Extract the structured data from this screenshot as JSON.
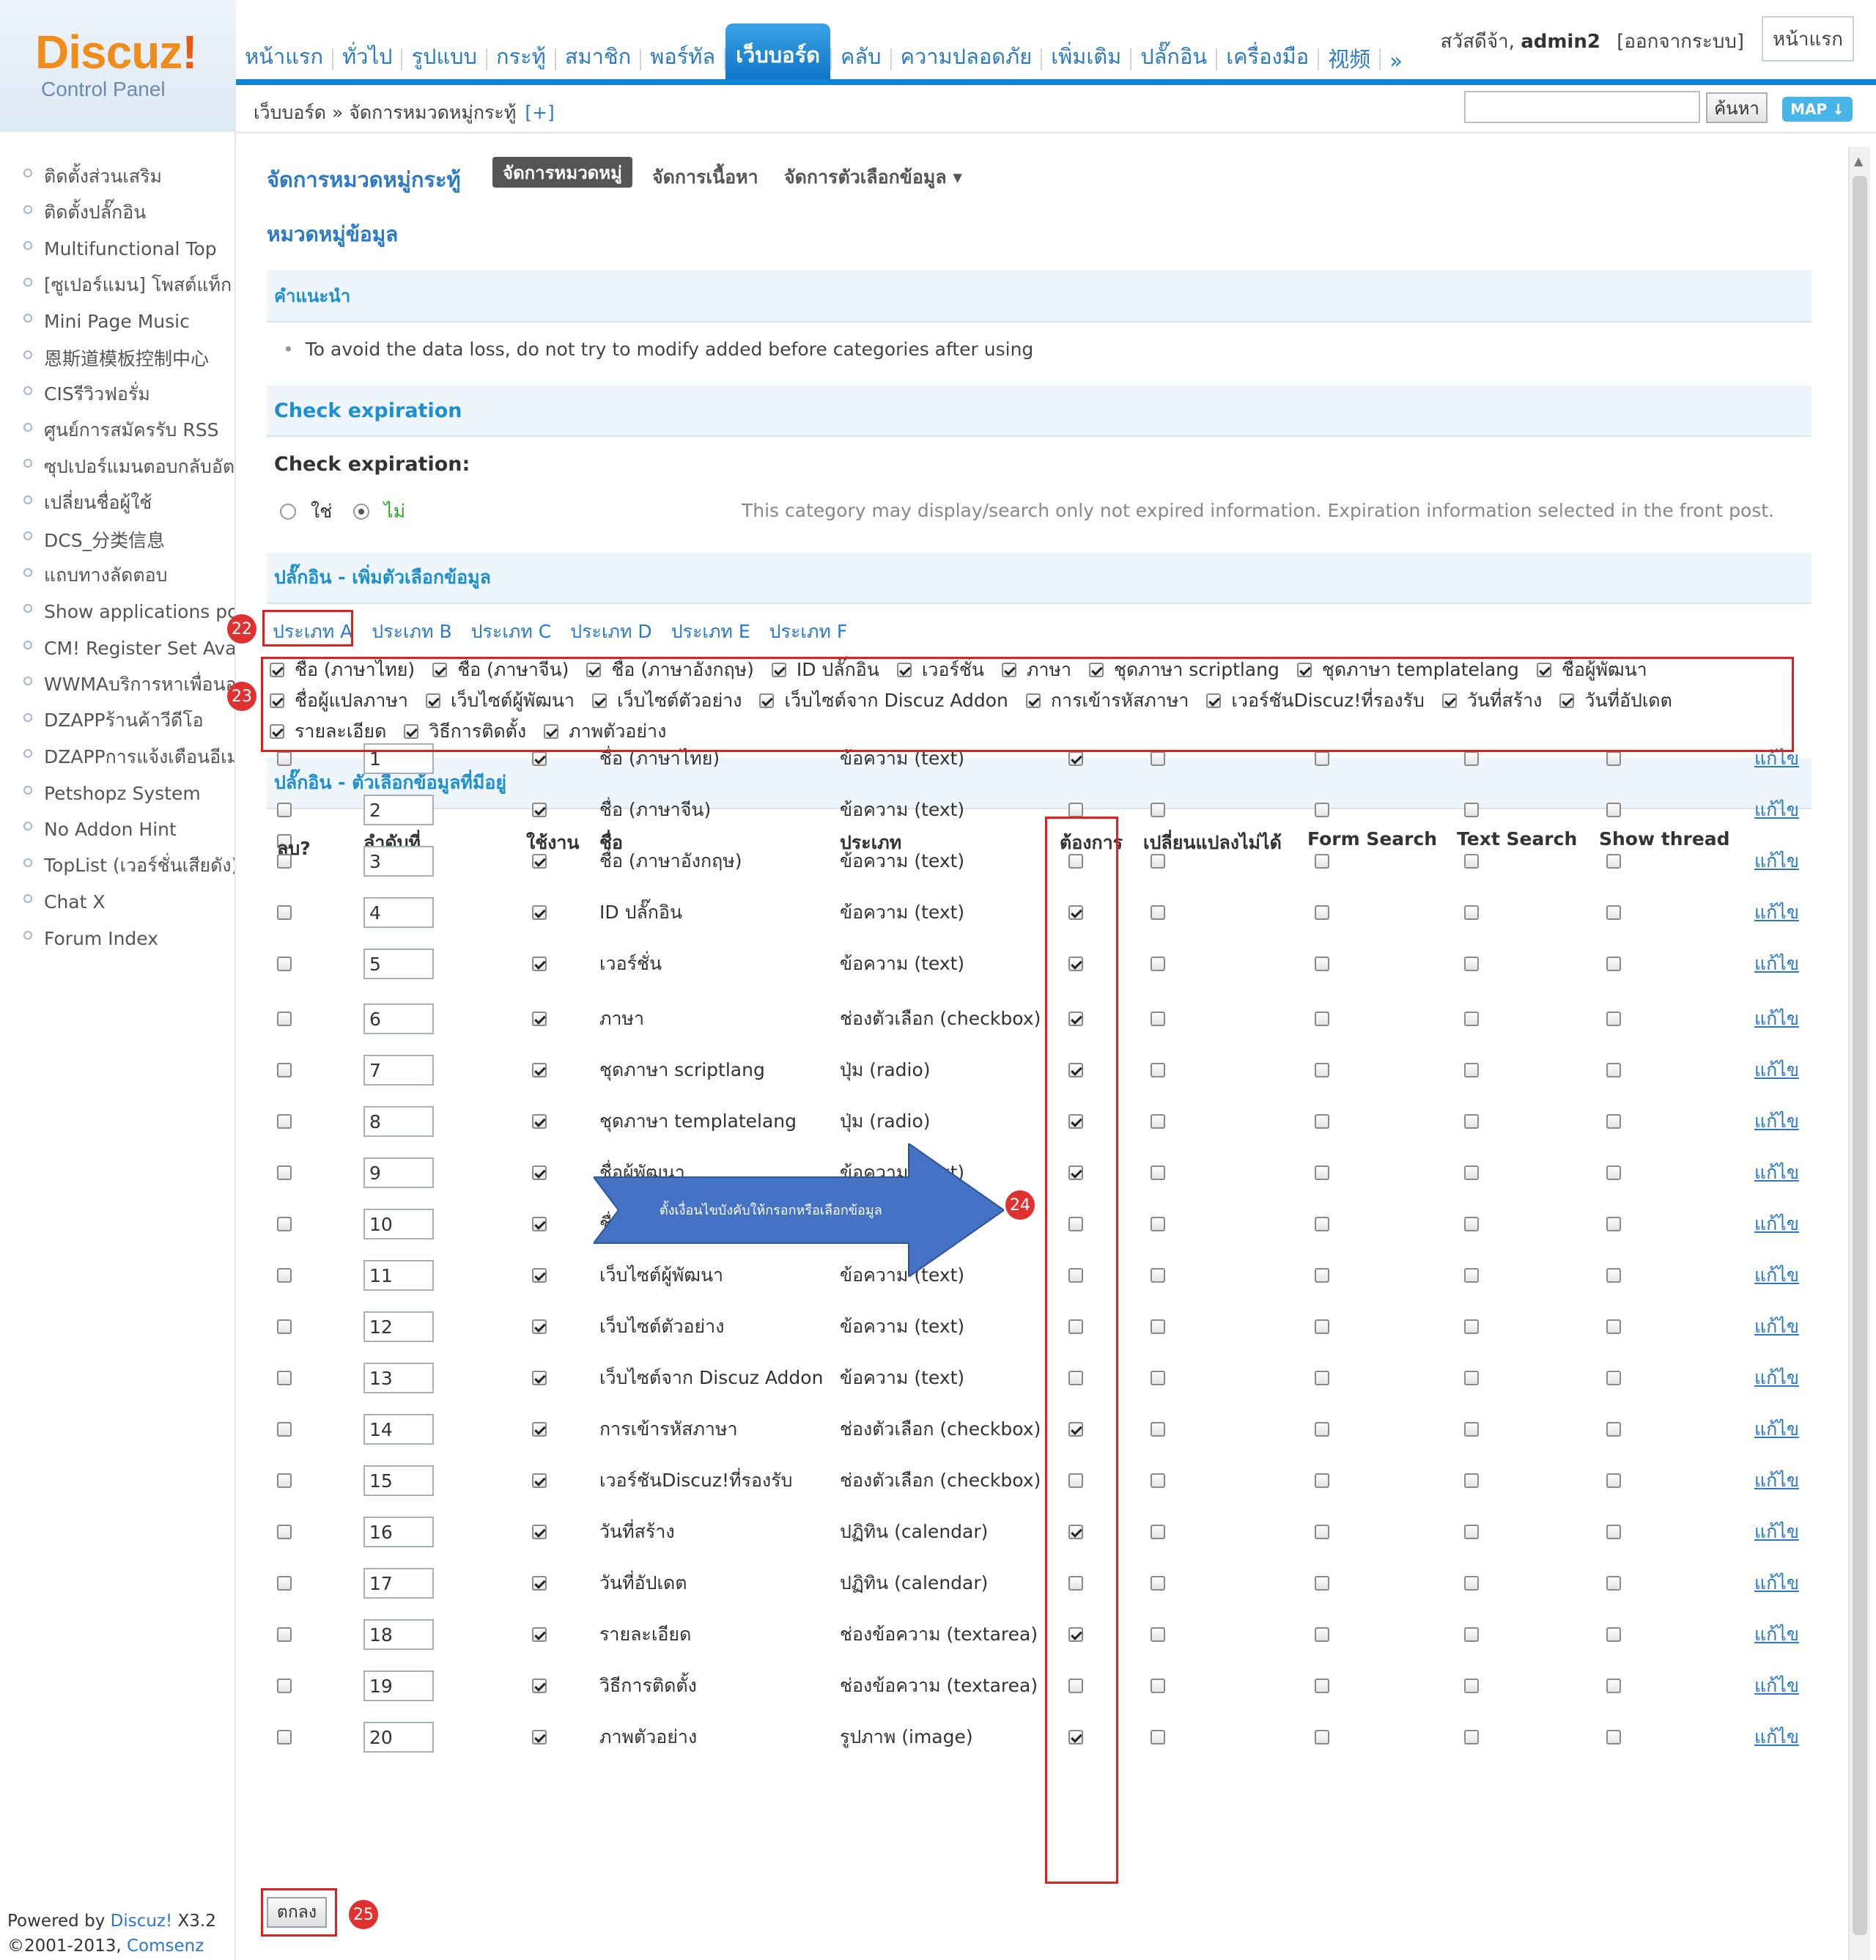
{
  "header": {
    "logo": "Discuz",
    "logo_bang": "!",
    "logo_sub": "Control Panel",
    "nav": [
      "หน้าแรก",
      "ทั่วไป",
      "รูปแบบ",
      "กระทู้",
      "สมาชิก",
      "พอร์ทัล",
      "เว็บบอร์ด",
      "คลับ",
      "ความปลอดภัย",
      "เพิ่มเติม",
      "ปลั๊กอิน",
      "เครื่องมือ",
      "视频",
      "»"
    ],
    "active_nav": "เว็บบอร์ด",
    "greeting": "สวัสดีจ้า,",
    "username": "admin2",
    "logout": "[ออกจากระบบ]",
    "home_button": "หน้าแรก",
    "breadcrumb": "เว็บบอร์ด » จัดการหมวดหมู่กระทู้",
    "breadcrumb_plus": "[+]",
    "search_button": "ค้นหา",
    "map_button": "MAP ↓"
  },
  "sidebar": {
    "items": [
      "ติดตั้งส่วนเสริม",
      "ติดตั้งปลั๊กอิน",
      "Multifunctional Top",
      "[ซูเปอร์แมน] โพสต์แท็ก",
      "Mini Page Music",
      "恩斯道模板控制中心",
      "CISรีวิวฟอรั่ม",
      "ศูนย์การสมัครรับ RSS",
      "ซุปเปอร์แมนตอบกลับอัตโ",
      "เปลี่ยนชื่อผู้ใช้",
      "DCS_分类信息",
      "แถบทางลัดตอบ",
      "Show applications po",
      "CM! Register Set Ava",
      "WWMAบริการหาเพื่อนอ",
      "DZAPPร้านค้าวีดีโอ",
      "DZAPPการแจ้งเตือนอีเมล",
      "Petshopz System",
      "No Addon Hint",
      "TopList (เวอร์ชั่นเสียดัง)",
      "Chat X",
      "Forum Index"
    ],
    "footer_powered": "Powered by",
    "footer_brand": "Discuz!",
    "footer_version": "X3.2",
    "footer_copy": "©2001-2013,",
    "footer_company": "Comsenz Inc."
  },
  "main": {
    "page_title": "จัดการหมวดหมู่กระทู้",
    "tabs": [
      "จัดการหมวดหมู่",
      "จัดการเนื้อหา",
      "จัดการตัวเลือกข้อมูล ▾"
    ],
    "subtitle": "หมวดหมู่ข้อมูล",
    "tip_title": "คำแนะนำ",
    "tip_text": "To avoid the data loss, do not try to modify added before categories after using",
    "check_expiration_title": "Check expiration",
    "check_expiration_label": "Check expiration:",
    "opt_yes": "ใช่",
    "opt_no": "ไม่",
    "check_expiration_desc": "This category may display/search only not expired information. Expiration information selected in the front post.",
    "add_section_title": "ปลั๊กอิน - เพิ่มตัวเลือกข้อมูล",
    "type_tabs": [
      "ประเภท A",
      "ประเภท B",
      "ประเภท C",
      "ประเภท D",
      "ประเภท E",
      "ประเภท F"
    ],
    "add_options": [
      "ชื่อ (ภาษาไทย)",
      "ชื่อ (ภาษาจีน)",
      "ชื่อ (ภาษาอังกฤษ)",
      "ID ปลั๊กอิน",
      "เวอร์ชั่น",
      "ภาษา",
      "ชุดภาษา scriptlang",
      "ชุดภาษา templatelang",
      "ชื่อผู้พัฒนา",
      "ชื่อผู้แปลภาษา",
      "เว็บไซต์ผู้พัฒนา",
      "เว็บไซต์ตัวอย่าง",
      "เว็บไซต์จาก Discuz Addon",
      "การเข้ารหัสภาษา",
      "เวอร์ชันDiscuz!ที่รองรับ",
      "วันที่สร้าง",
      "วันที่อัปเดต",
      "รายละเอียด",
      "วิธีการติดตั้ง",
      "ภาพตัวอย่าง"
    ],
    "existing_section_title": "ปลั๊กอิน - ตัวเลือกข้อมูลที่มีอยู่",
    "columns": [
      "ลบ?",
      "ลำดับที่",
      "ใช้งาน",
      "ชื่อ",
      "ประเภท",
      "ต้องการ",
      "เปลี่ยนแปลงไม่ได้",
      "Form Search",
      "Text Search",
      "Show thread"
    ],
    "edit_label": "แก้ไข",
    "rows": [
      {
        "order": "1",
        "name": "ชื่อ (ภาษาไทย)",
        "type": "ข้อความ (text)",
        "required": true
      },
      {
        "order": "2",
        "name": "ชื่อ (ภาษาจีน)",
        "type": "ข้อความ (text)",
        "required": false
      },
      {
        "order": "3",
        "name": "ชื่อ (ภาษาอังกฤษ)",
        "type": "ข้อความ (text)",
        "required": false
      },
      {
        "order": "4",
        "name": "ID ปลั๊กอิน",
        "type": "ข้อความ (text)",
        "required": true
      },
      {
        "order": "5",
        "name": "เวอร์ชั่น",
        "type": "ข้อความ (text)",
        "required": true
      },
      {
        "order": "6",
        "name": "ภาษา",
        "type": "ช่องตัวเลือก (checkbox)",
        "required": true
      },
      {
        "order": "7",
        "name": "ชุดภาษา scriptlang",
        "type": "ปุ่ม (radio)",
        "required": true
      },
      {
        "order": "8",
        "name": "ชุดภาษา templatelang",
        "type": "ปุ่ม (radio)",
        "required": true
      },
      {
        "order": "9",
        "name": "ชื่อผู้พัฒนา",
        "type": "ข้อความ (text)",
        "required": true
      },
      {
        "order": "10",
        "name": "ชื่อผู้แปลภาษา",
        "type": "ข้อความ (text)",
        "required": false
      },
      {
        "order": "11",
        "name": "เว็บไซต์ผู้พัฒนา",
        "type": "ข้อความ (text)",
        "required": false
      },
      {
        "order": "12",
        "name": "เว็บไซต์ตัวอย่าง",
        "type": "ข้อความ (text)",
        "required": false
      },
      {
        "order": "13",
        "name": "เว็บไซต์จาก Discuz Addon",
        "type": "ข้อความ (text)",
        "required": false
      },
      {
        "order": "14",
        "name": "การเข้ารหัสภาษา",
        "type": "ช่องตัวเลือก (checkbox)",
        "required": true
      },
      {
        "order": "15",
        "name": "เวอร์ชันDiscuz!ที่รองรับ",
        "type": "ช่องตัวเลือก (checkbox)",
        "required": false
      },
      {
        "order": "16",
        "name": "วันที่สร้าง",
        "type": "ปฏิทิน (calendar)",
        "required": true
      },
      {
        "order": "17",
        "name": "วันที่อัปเดต",
        "type": "ปฏิทิน (calendar)",
        "required": false
      },
      {
        "order": "18",
        "name": "รายละเอียด",
        "type": "ช่องข้อความ (textarea)",
        "required": true
      },
      {
        "order": "19",
        "name": "วิธีการติดตั้ง",
        "type": "ช่องข้อความ (textarea)",
        "required": false
      },
      {
        "order": "20",
        "name": "ภาพตัวอย่าง",
        "type": "รูปภาพ (image)",
        "required": true
      }
    ],
    "submit_button": "ตกลง"
  },
  "annotations": {
    "badges": [
      "22",
      "23",
      "24",
      "25"
    ],
    "arrow_text": "ตั้งเงื่อนไขบังคับให้กรอกหรือเลือกข้อมูล"
  },
  "colors": {
    "link_blue": "#2b7ac9",
    "nav_active": "#0f74c7",
    "annotation_red": "#e02020",
    "arrow_blue": "#4472c4"
  }
}
